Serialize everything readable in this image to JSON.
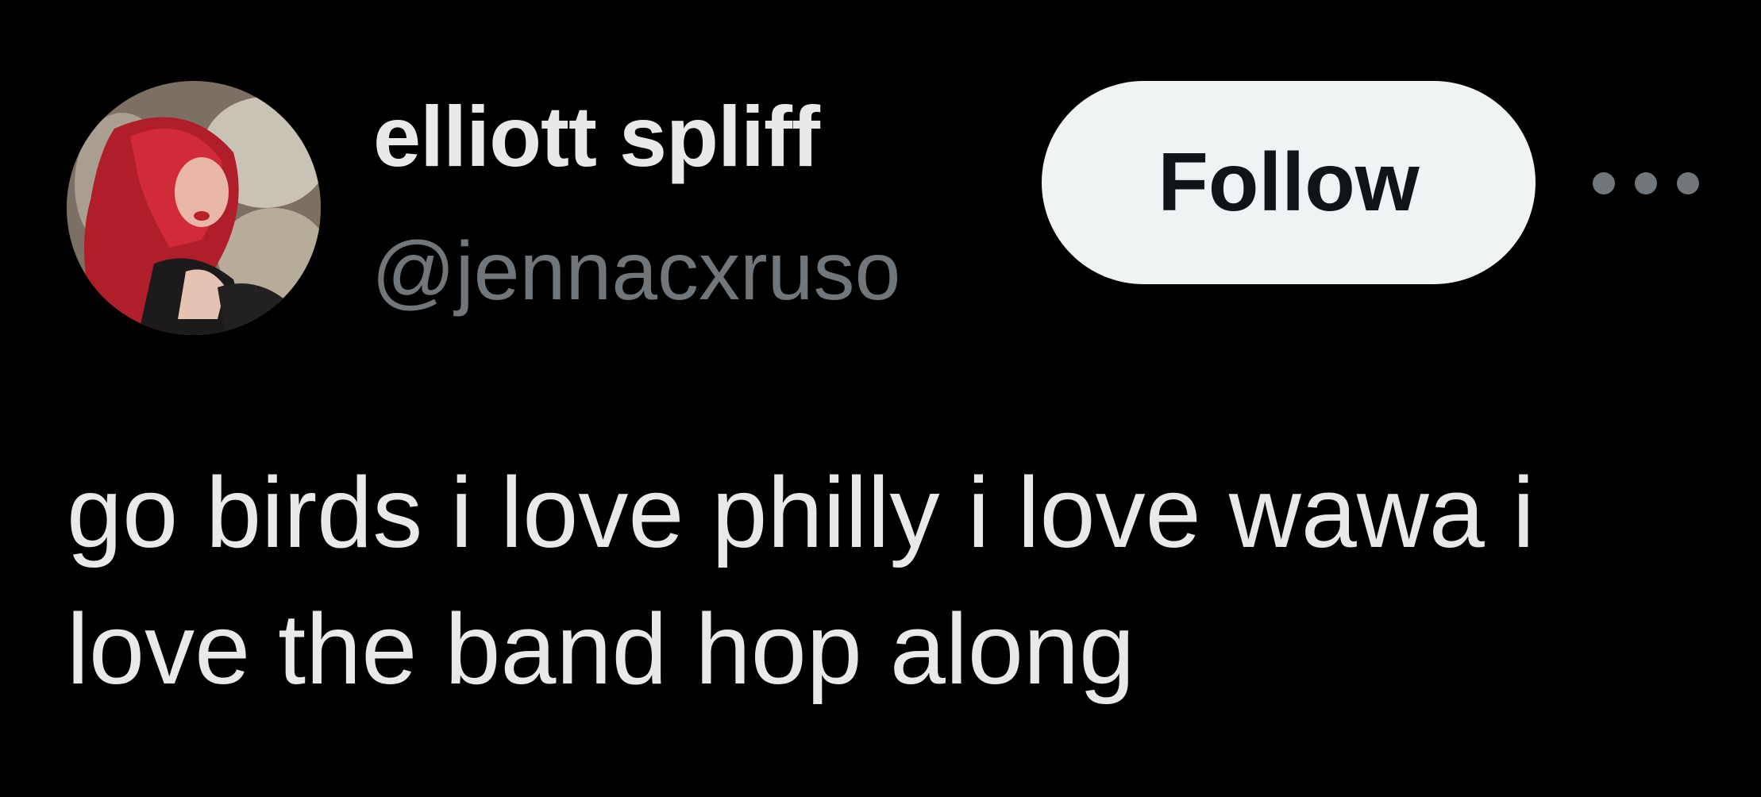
{
  "tweet": {
    "author": {
      "display_name": "elliott spliff",
      "handle": "@jennacxruso"
    },
    "follow_label": "Follow",
    "more_icon": "ellipsis-horizontal-icon",
    "text_line_1": "go birds i love philly i love wawa i",
    "text_line_2": "love the band hop along"
  },
  "colors": {
    "background": "#000000",
    "primary_text": "#e7e9ea",
    "secondary_text": "#71767b",
    "follow_button_bg": "#eff3f4",
    "follow_button_text": "#0f1419"
  }
}
